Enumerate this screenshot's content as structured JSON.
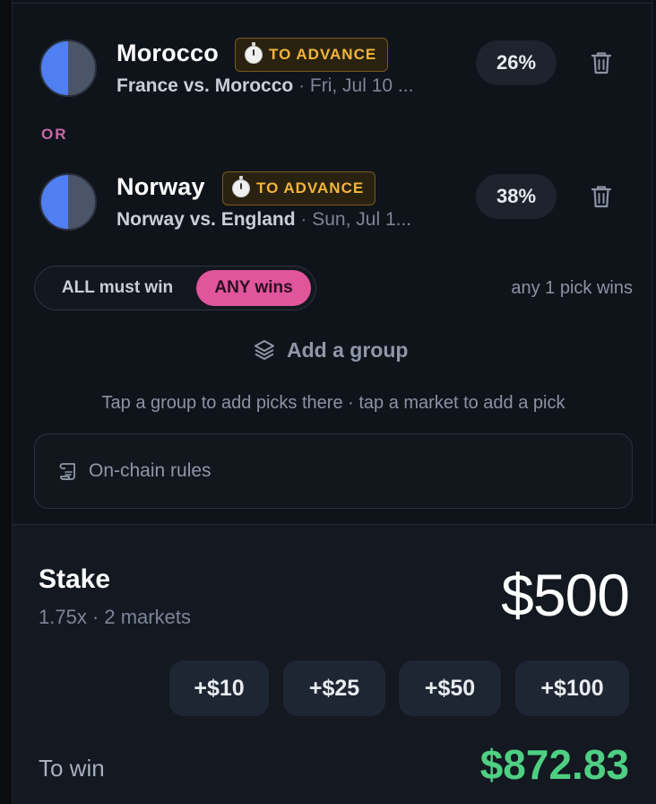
{
  "picks": [
    {
      "team": "Morocco",
      "tag": "TO ADVANCE",
      "match": "France vs. Morocco",
      "date": "Fri, Jul 10 ...",
      "odds": "26%"
    },
    {
      "team": "Norway",
      "tag": "TO ADVANCE",
      "match": "Norway vs. England",
      "date": "Sun, Jul 1...",
      "odds": "38%"
    }
  ],
  "group": {
    "connector": "OR",
    "mode_all_label": "ALL must win",
    "mode_any_label": "ANY wins",
    "selected_mode": "ANY wins",
    "caption": "any 1 pick wins"
  },
  "add_group_label": "Add a group",
  "hint": "Tap a group to add picks there · tap a market to add a pick",
  "rules_label": "On-chain rules",
  "stake": {
    "title": "Stake",
    "subtitle": "1.75x · 2 markets",
    "amount": "$500",
    "chips": [
      "+$10",
      "+$25",
      "+$50",
      "+$100"
    ]
  },
  "to_win": {
    "label": "To win",
    "amount": "$872.83"
  },
  "colors": {
    "accent_pink": "#e0559c",
    "tag_gold": "#f2b53a",
    "win_green": "#4ecf82",
    "avatar_blue": "#4f7ff0"
  }
}
